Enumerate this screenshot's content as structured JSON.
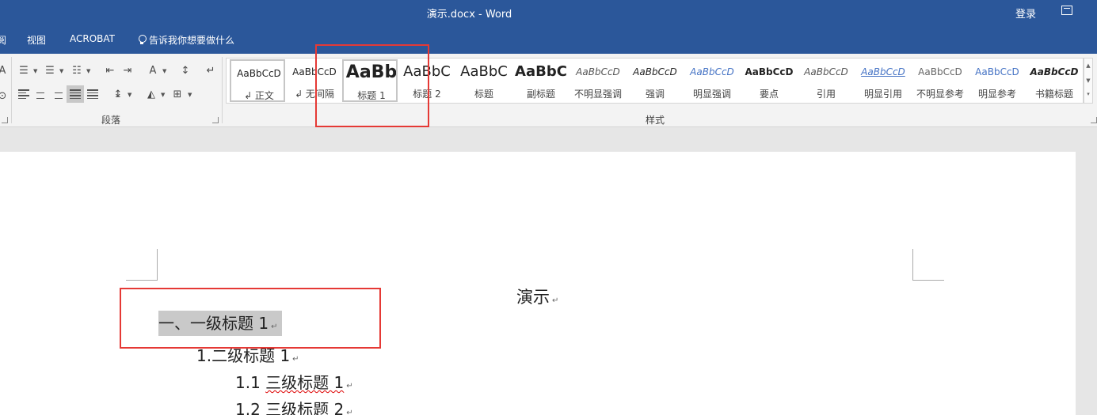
{
  "window": {
    "title": "演示.docx  -  Word",
    "login": "登录"
  },
  "tabs": [
    {
      "label": "阅"
    },
    {
      "label": "视图"
    },
    {
      "label": "ACROBAT"
    }
  ],
  "tell_me": "告诉我你想要做什么",
  "ribbon": {
    "paragraph_group_label": "段落",
    "styles_group_label": "样式"
  },
  "styles": [
    {
      "sample": "AaBbCcD",
      "label": "↲ 正文"
    },
    {
      "sample": "AaBbCcD",
      "label": "↲ 无间隔"
    },
    {
      "sample": "AaBb",
      "label": "标题 1"
    },
    {
      "sample": "AaBbC",
      "label": "标题 2"
    },
    {
      "sample": "AaBbC",
      "label": "标题"
    },
    {
      "sample": "AaBbC",
      "label": "副标题"
    },
    {
      "sample": "AaBbCcD",
      "label": "不明显强调"
    },
    {
      "sample": "AaBbCcD",
      "label": "强调"
    },
    {
      "sample": "AaBbCcD",
      "label": "明显强调"
    },
    {
      "sample": "AaBbCcD",
      "label": "要点"
    },
    {
      "sample": "AaBbCcD",
      "label": "引用"
    },
    {
      "sample": "AaBbCcD",
      "label": "明显引用"
    },
    {
      "sample": "AaBbCcD",
      "label": "不明显参考"
    },
    {
      "sample": "AaBbCcD",
      "label": "明显参考"
    },
    {
      "sample": "AaBbCcD",
      "label": "书籍标题"
    }
  ],
  "document": {
    "title": "演示",
    "heading1": "一、一级标题 1",
    "heading2": "1.二级标题 1",
    "heading3a_num": "1.1",
    "heading3a_text": "三级标题 1",
    "heading3b_num": "1.2",
    "heading3b_text": "三级标题 2",
    "para_mark": "↵"
  },
  "colors": {
    "titlebar": "#2b579a",
    "highlight": "#c9c9c9",
    "annotation": "#e53935"
  }
}
